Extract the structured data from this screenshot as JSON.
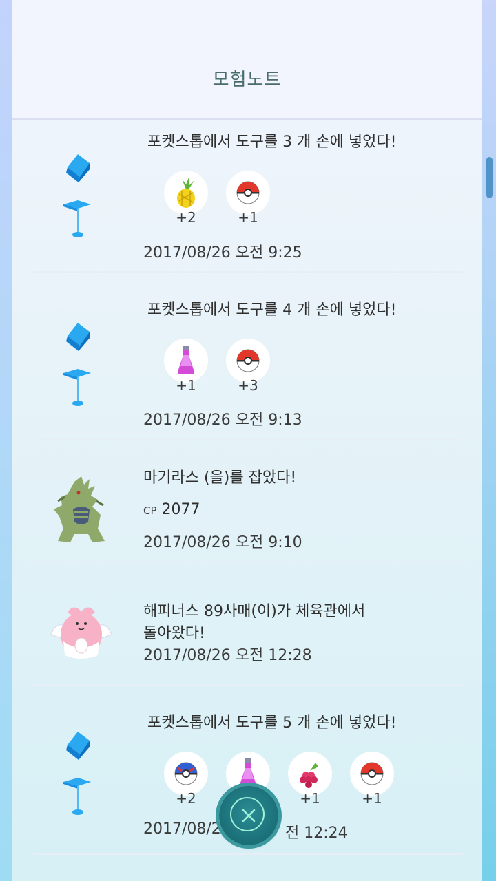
{
  "header": {
    "title": "모험노트"
  },
  "entries": [
    {
      "type": "pokestop",
      "headline": "포켓스톱에서 도구를 3 개 손에 넣었다!",
      "items": [
        {
          "icon": "pinap-berry-icon",
          "count": "+2"
        },
        {
          "icon": "poke-ball-icon",
          "count": "+1"
        }
      ],
      "time": "2017/08/26 오전 9:25"
    },
    {
      "type": "pokestop",
      "headline": "포켓스톱에서 도구를 4 개 손에 넣었다!",
      "items": [
        {
          "icon": "potion-icon",
          "count": "+1"
        },
        {
          "icon": "poke-ball-icon",
          "count": "+3"
        }
      ],
      "time": "2017/08/26 오전 9:13"
    },
    {
      "type": "catch",
      "headline": "마기라스 (을)를 잡았다!",
      "cp_label": "CP",
      "cp_value": "2077",
      "time": "2017/08/26 오전 9:10"
    },
    {
      "type": "gym-return",
      "headline_line1": "해피너스 89사매(이)가 체육관에서",
      "headline_line2": "돌아왔다!",
      "time": "2017/08/26 오전 12:28"
    },
    {
      "type": "pokestop",
      "headline": "포켓스톱에서 도구를 5 개 손에 넣었다!",
      "items": [
        {
          "icon": "great-ball-icon",
          "count": "+2"
        },
        {
          "icon": "potion-icon",
          "count": ""
        },
        {
          "icon": "razz-berry-icon",
          "count": "+1"
        },
        {
          "icon": "poke-ball-icon",
          "count": "+1"
        }
      ],
      "time_left": "2017/08/2",
      "time_right": "전 12:24"
    }
  ],
  "colors": {
    "accent": "#1b6f77",
    "pokestop_blue": "#2aa8f0",
    "title": "#4a6c6a"
  }
}
